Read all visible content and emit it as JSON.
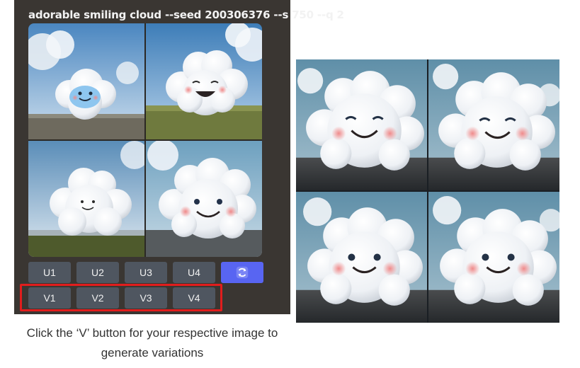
{
  "prompt": "adorable smiling cloud --seed 200306376 --s 750 --q 2",
  "upscale_buttons": [
    "U1",
    "U2",
    "U3",
    "U4"
  ],
  "variation_buttons": [
    "V1",
    "V2",
    "V3",
    "V4"
  ],
  "refresh_icon": "refresh-icon",
  "caption": "Click the ‘V’ button for your respective image to generate variations",
  "colors": {
    "panel": "#3a3632",
    "button": "#4f5660",
    "refresh": "#5865f2",
    "highlight": "#e11d1d"
  }
}
